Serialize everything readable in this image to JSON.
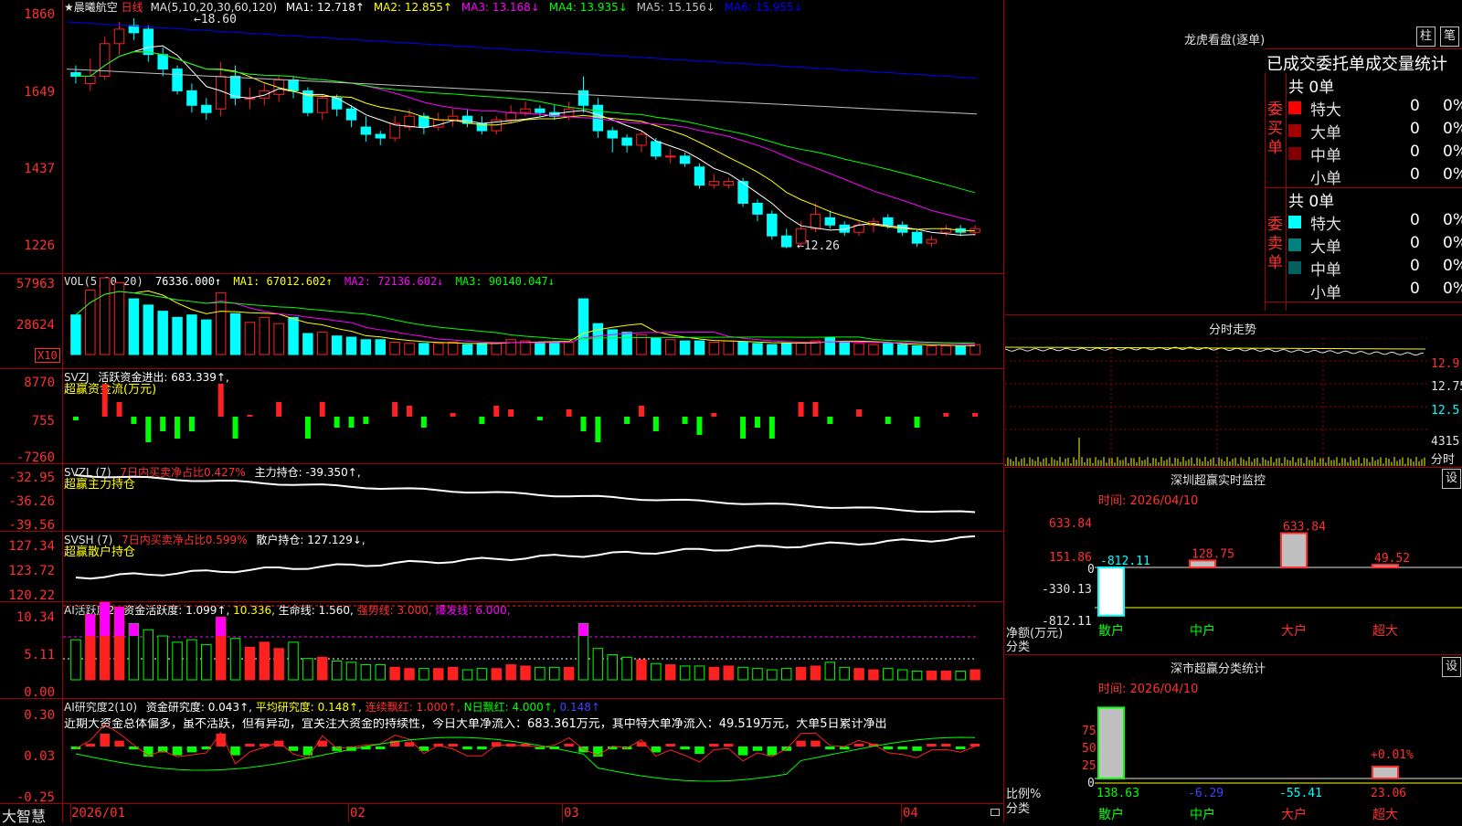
{
  "colors": {
    "up": "#ff2020",
    "down": "#00ffff",
    "ma1": "#ffffff",
    "ma2": "#ffff00",
    "ma3": "#ff00ff",
    "ma4": "#00ff00",
    "ma5": "#c0c0c0",
    "ma6": "#0000ff",
    "grid": "#a00000"
  },
  "brand": "大智慧",
  "main": {
    "stock_name": "★晨曦航空",
    "period": "日线",
    "ma_label": "MA(5,10,20,30,60,120)",
    "ma1": "MA1: 12.718↑",
    "ma2": "MA2: 12.855↑",
    "ma3": "MA3: 13.168↓",
    "ma4": "MA4: 13.935↓",
    "ma5": "MA5: 15.156↓",
    "ma6": "MA6: 15.955↓",
    "high_mark": "←18.60",
    "low_mark": "←12.26",
    "y_ticks": [
      "1860",
      "1649",
      "1437",
      "1226"
    ]
  },
  "vol": {
    "label": "VOL(5,10,20)",
    "value": "76336.000↑",
    "ma1": "MA1: 67012.602↑",
    "ma2": "MA2: 72136.602↓",
    "ma3": "MA3: 90140.047↓",
    "y_ticks": [
      "57963",
      "28624"
    ],
    "unit": "X10"
  },
  "svzj": {
    "label": "SVZJ",
    "title": "活跃资金进出: 683.339↑,",
    "sub": "超赢资金流(万元)",
    "y_ticks": [
      "8770",
      "755",
      "-7260"
    ]
  },
  "svzl": {
    "label": "SVZL (7)",
    "ratio": "7日内买卖净占比0.427%",
    "hold": "主力持仓: -39.350↑,",
    "sub": "超赢主力持仓",
    "y_ticks": [
      "-32.95",
      "-36.26",
      "-39.56"
    ]
  },
  "svsh": {
    "label": "SVSH (7)",
    "ratio": "7日内买卖净占比0.599%",
    "hold": "散户持仓: 127.129↓,",
    "sub": "超赢散户持仓",
    "y_ticks": [
      "127.34",
      "123.72",
      "120.22"
    ]
  },
  "ai1": {
    "label": "AI活跃度2",
    "a": "资金活跃度: 1.099↑,",
    "b": "10.336,",
    "c": "生命线: 1.560,",
    "d": "强势线: 3.000,",
    "e": "爆发线: 6.000,",
    "y_ticks": [
      "10.34",
      "5.11",
      "0.00"
    ]
  },
  "ai2": {
    "label": "AI研究度2(10)",
    "a": "资金研究度: 0.043↑,",
    "b": "平均研究度: 0.148↑,",
    "c": "连续飘红: 1.000↑,",
    "d": "N日飘红: 4.000↑,",
    "e": "0.148↑",
    "comment": "近期大资金总体偏多，虽不活跃，但有异动，宜关注大资金的持续性，今日大单净流入：683.361万元，其中特大单净流入：49.519万元，大单5日累计净出",
    "y_ticks": [
      "0.30",
      "0.03",
      "-0.25"
    ]
  },
  "x_axis": [
    "2026/01",
    "02",
    "03",
    "04"
  ],
  "right": {
    "title": "龙虎看盘(逐单)",
    "btn_zhu": "柱",
    "btn_bi": "笔",
    "stat_title": "已成交委托单成交量统计",
    "buy_head": "共 0单",
    "buy_label": "委买单",
    "sell_head": "共 0单",
    "sell_label": "委卖单",
    "rows_buy": [
      {
        "name": "特大",
        "n": "0",
        "p": "0%",
        "c": "#ff0000"
      },
      {
        "name": "大单",
        "n": "0",
        "p": "0%",
        "c": "#a00000"
      },
      {
        "name": "中单",
        "n": "0",
        "p": "0%",
        "c": "#800000"
      },
      {
        "name": "小单",
        "n": "0",
        "p": "0%",
        "c": "#000000"
      }
    ],
    "rows_sell": [
      {
        "name": "特大",
        "n": "0",
        "p": "0%",
        "c": "#00ffff"
      },
      {
        "name": "大单",
        "n": "0",
        "p": "0%",
        "c": "#008080"
      },
      {
        "name": "中单",
        "n": "0",
        "p": "0%",
        "c": "#006060"
      },
      {
        "name": "小单",
        "n": "0",
        "p": "0%",
        "c": "#000000"
      }
    ],
    "intraday_title": "分时走势",
    "intraday_y": [
      "12.9",
      "12.75",
      "12.5"
    ],
    "intraday_vol": "4315",
    "intraday_label": "分时",
    "monitor_title": "深圳超赢实时监控",
    "monitor_btn": "设",
    "monitor_time": "时间: 2026/04/10",
    "monitor_y": [
      "633.84",
      "151.86",
      "0",
      "-330.13",
      "-812.11"
    ],
    "monitor_axis_label": "净额(万元)",
    "monitor_cat_label": "分类",
    "monitor_chart": {
      "type": "bar",
      "categories": [
        "散户",
        "中户",
        "大户",
        "超大"
      ],
      "values": [
        -812.11,
        128.75,
        633.84,
        49.52
      ],
      "labels": [
        "-812.11",
        "128.75",
        "633.84",
        "49.52"
      ]
    },
    "class_title": "深市超赢分类统计",
    "class_btn": "设",
    "class_time": "时间: 2026/04/10",
    "class_y": [
      "75",
      "50",
      "25",
      "0"
    ],
    "class_axis_label": "比例%",
    "class_cat_label": "分类",
    "class_chart": {
      "type": "bar",
      "categories": [
        "散户",
        "中户",
        "大户",
        "超大"
      ],
      "values": [
        138.63,
        -6.29,
        -55.41,
        23.06
      ],
      "extra": "+0.01%"
    }
  },
  "chart_data": [
    {
      "type": "candlestick",
      "title": "晨曦航空 日线",
      "x_ticks": [
        "2026/01",
        "02",
        "03",
        "04"
      ],
      "ylim": [
        12.26,
        18.6
      ],
      "candles": [
        [
          17.1,
          17.0,
          17.3,
          16.8
        ],
        [
          16.8,
          17.0,
          17.5,
          16.6
        ],
        [
          17.0,
          17.9,
          18.1,
          16.9
        ],
        [
          17.9,
          18.3,
          18.5,
          17.6
        ],
        [
          18.4,
          18.2,
          18.6,
          18.0
        ],
        [
          18.3,
          17.6,
          18.4,
          17.4
        ],
        [
          17.6,
          17.2,
          17.8,
          17.0
        ],
        [
          17.2,
          16.6,
          17.3,
          16.5
        ],
        [
          16.6,
          16.2,
          16.8,
          16.0
        ],
        [
          16.2,
          16.0,
          16.4,
          15.8
        ],
        [
          16.1,
          17.0,
          17.4,
          15.9
        ],
        [
          17.0,
          16.4,
          17.3,
          16.2
        ],
        [
          16.4,
          16.4,
          16.7,
          16.1
        ],
        [
          16.4,
          16.6,
          16.8,
          16.2
        ],
        [
          16.5,
          16.9,
          17.0,
          16.3
        ],
        [
          16.9,
          16.6,
          17.0,
          16.4
        ],
        [
          16.6,
          16.0,
          16.7,
          15.9
        ],
        [
          16.0,
          16.4,
          16.5,
          15.8
        ],
        [
          16.4,
          16.1,
          16.5,
          15.9
        ],
        [
          16.1,
          15.8,
          16.2,
          15.6
        ],
        [
          15.6,
          15.4,
          15.9,
          15.2
        ],
        [
          15.4,
          15.3,
          15.5,
          15.1
        ],
        [
          15.3,
          15.7,
          15.9,
          15.2
        ],
        [
          15.6,
          15.9,
          16.1,
          15.5
        ],
        [
          15.9,
          15.6,
          16.0,
          15.4
        ],
        [
          15.6,
          15.8,
          16.0,
          15.5
        ],
        [
          15.8,
          15.9,
          16.1,
          15.6
        ],
        [
          15.9,
          15.7,
          16.1,
          15.6
        ],
        [
          15.7,
          15.5,
          15.9,
          15.4
        ],
        [
          15.5,
          15.8,
          15.9,
          15.4
        ],
        [
          15.8,
          16.0,
          16.2,
          15.7
        ],
        [
          16.0,
          16.1,
          16.3,
          15.9
        ],
        [
          16.1,
          16.0,
          16.2,
          15.9
        ],
        [
          16.0,
          15.9,
          16.2,
          15.8
        ],
        [
          15.9,
          16.1,
          16.3,
          15.8
        ],
        [
          16.6,
          16.2,
          17.0,
          16.0
        ],
        [
          16.2,
          15.5,
          16.4,
          15.3
        ],
        [
          15.5,
          15.3,
          15.6,
          14.9
        ],
        [
          15.3,
          15.1,
          15.4,
          14.9
        ],
        [
          15.1,
          15.4,
          15.5,
          14.9
        ],
        [
          15.2,
          14.8,
          15.3,
          14.7
        ],
        [
          14.8,
          14.8,
          15.0,
          14.6
        ],
        [
          14.8,
          14.6,
          14.9,
          14.5
        ],
        [
          14.5,
          14.0,
          14.6,
          13.9
        ],
        [
          14.0,
          14.1,
          14.3,
          13.9
        ],
        [
          14.0,
          14.1,
          14.2,
          13.9
        ],
        [
          14.1,
          13.5,
          14.2,
          13.4
        ],
        [
          13.5,
          13.2,
          13.6,
          13.0
        ],
        [
          13.2,
          12.6,
          13.3,
          12.5
        ],
        [
          12.6,
          12.3,
          12.8,
          12.26
        ],
        [
          12.4,
          12.8,
          13.0,
          12.3
        ],
        [
          12.8,
          13.2,
          13.5,
          12.7
        ],
        [
          13.1,
          12.9,
          13.3,
          12.8
        ],
        [
          12.9,
          12.7,
          13.0,
          12.6
        ],
        [
          12.7,
          12.9,
          13.0,
          12.6
        ],
        [
          12.9,
          13.0,
          13.1,
          12.7
        ],
        [
          13.1,
          12.9,
          13.2,
          12.8
        ],
        [
          12.9,
          12.7,
          13.0,
          12.6
        ],
        [
          12.7,
          12.4,
          12.8,
          12.3
        ],
        [
          12.4,
          12.5,
          12.6,
          12.3
        ],
        [
          12.7,
          12.8,
          12.9,
          12.6
        ],
        [
          12.8,
          12.7,
          12.9,
          12.6
        ],
        [
          12.7,
          12.8,
          12.9,
          12.6
        ]
      ]
    },
    {
      "type": "bar",
      "title": "VOL",
      "y_ticks": [
        57963,
        28624
      ],
      "values": [
        32000,
        52000,
        62000,
        58000,
        45000,
        40000,
        35000,
        30000,
        32000,
        28000,
        50000,
        33000,
        26000,
        30000,
        25000,
        30000,
        17000,
        18000,
        15000,
        14000,
        12000,
        12000,
        10000,
        9000,
        9000,
        9000,
        10000,
        8000,
        9000,
        9000,
        12000,
        11000,
        10000,
        10000,
        10000,
        45000,
        25000,
        20000,
        18000,
        16000,
        13000,
        12000,
        11000,
        11000,
        10000,
        11000,
        10000,
        9000,
        8000,
        9000,
        10000,
        11000,
        14000,
        10000,
        9000,
        8000,
        9000,
        8000,
        7000,
        7000,
        7000,
        7000,
        8000
      ]
    }
  ]
}
